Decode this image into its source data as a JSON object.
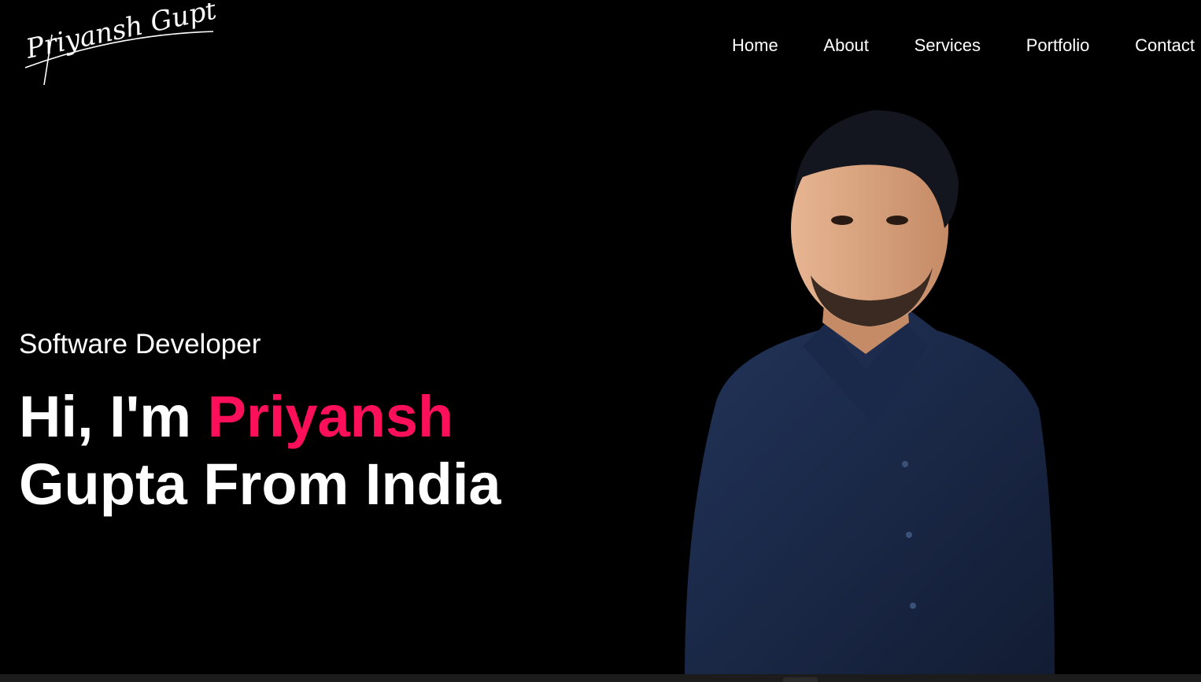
{
  "header": {
    "logo_text": "Priyansh Gupta",
    "nav": [
      {
        "label": "Home"
      },
      {
        "label": "About"
      },
      {
        "label": "Services"
      },
      {
        "label": "Portfolio"
      },
      {
        "label": "Contact"
      }
    ]
  },
  "hero": {
    "subtitle": "Software Developer",
    "headline_prefix": "Hi, I'm ",
    "headline_highlight": "Priyansh",
    "headline_line2": "Gupta From India",
    "highlight_color": "#fe0f5a",
    "portrait_icon": "person-portrait-icon"
  },
  "colors": {
    "background": "#000000",
    "text": "#ffffff",
    "accent": "#fe0f5a",
    "shirt": "#1b2a4a"
  }
}
